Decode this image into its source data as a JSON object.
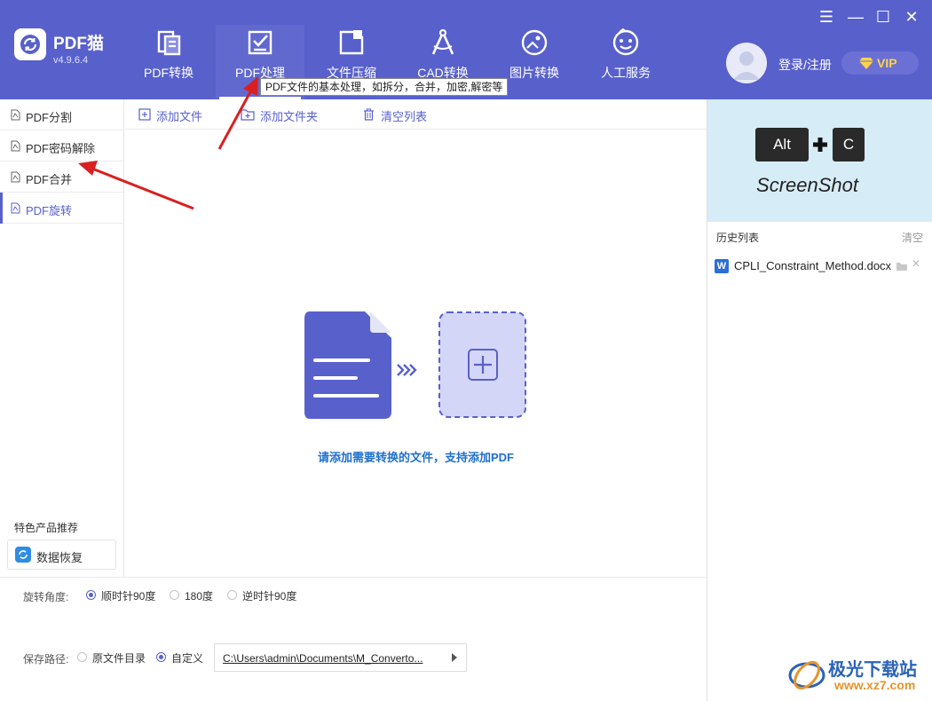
{
  "app": {
    "name": "PDF猫",
    "version": "v4.9.6.4"
  },
  "nav": [
    {
      "label": "PDF转换",
      "icon": "pdf-convert-icon"
    },
    {
      "label": "PDF处理",
      "icon": "pdf-process-icon"
    },
    {
      "label": "文件压缩",
      "icon": "file-compress-icon"
    },
    {
      "label": "CAD转换",
      "icon": "cad-convert-icon"
    },
    {
      "label": "图片转换",
      "icon": "image-convert-icon"
    },
    {
      "label": "人工服务",
      "icon": "customer-service-icon"
    }
  ],
  "tooltip": "PDF文件的基本处理，如拆分，合并，加密,解密等",
  "window_controls": {
    "menu": "☰",
    "minimize": "—",
    "maximize": "☐",
    "close": "✕"
  },
  "account": {
    "login_label": "登录/注册",
    "vip_label": "VIP"
  },
  "sidebar": {
    "items": [
      {
        "label": "PDF分割"
      },
      {
        "label": "PDF密码解除"
      },
      {
        "label": "PDF合并"
      },
      {
        "label": "PDF旋转"
      }
    ],
    "featured_label": "特色产品推荐",
    "featured_item": "数据恢复"
  },
  "toolbar": {
    "add_file": "添加文件",
    "add_folder": "添加文件夹",
    "clear_list": "清空列表"
  },
  "drop_area": {
    "hint": "请添加需要转换的文件，支持添加PDF"
  },
  "right_panel": {
    "ad_key1": "Alt",
    "ad_plus": "+",
    "ad_key2": "C",
    "ad_caption": "ScreenShot",
    "history_title": "历史列表",
    "history_clear": "清空",
    "history_items": [
      {
        "icon_letter": "W",
        "name": "CPLI_Constraint_Method.docx"
      }
    ]
  },
  "options": {
    "rotate_label": "旋转角度:",
    "rotate_options": [
      "顺时针90度",
      "180度",
      "逆时针90度"
    ],
    "rotate_selected": "顺时针90度",
    "save_label": "保存路径:",
    "save_options": [
      "原文件目录",
      "自定义"
    ],
    "save_selected": "自定义",
    "save_path": "C:\\Users\\admin\\Documents\\M_Converto..."
  },
  "watermark": {
    "text": "极光下载站",
    "url": "www.xz7.com"
  },
  "colors": {
    "header": "#5860cc",
    "accent": "#5860cc",
    "link_blue": "#1f6fd0",
    "arrow_red": "#d82020",
    "ad_bg": "#d6ecf7"
  }
}
